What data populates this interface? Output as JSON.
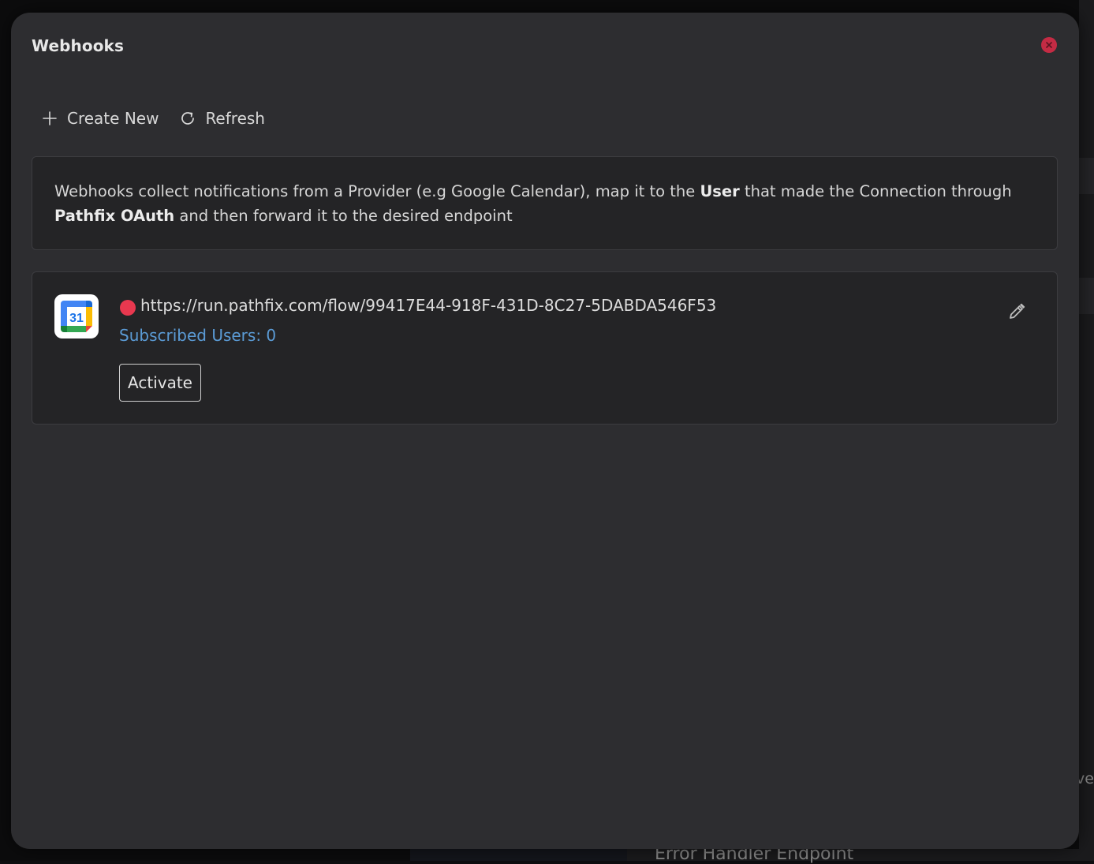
{
  "backdrop": {
    "peek_text": "ve",
    "bottom_text": "Error Handler Endpoint"
  },
  "modal": {
    "title": "Webhooks",
    "close_icon": "close-icon"
  },
  "toolbar": {
    "create_label": "Create New",
    "create_icon": "plus-icon",
    "refresh_label": "Refresh",
    "refresh_icon": "refresh-icon"
  },
  "info": {
    "part1": "Webhooks collect notifications from a Provider (e.g Google Calendar), map it to the ",
    "bold1": "User",
    "part2": " that made the Connection through ",
    "bold2": "Pathfix OAuth",
    "part3": " and then forward it to the desired endpoint"
  },
  "webhooks": [
    {
      "provider_icon": "google-calendar-icon",
      "calendar_day": "31",
      "status_color": "#e8384f",
      "url": "https://run.pathfix.com/flow/99417E44-918F-431D-8C27-5DABDA546F53",
      "subscribed_label": "Subscribed Users: 0",
      "activate_label": "Activate",
      "edit_icon": "pencil-icon"
    }
  ],
  "colors": {
    "modal_bg": "#2d2d30",
    "card_bg": "#242426",
    "link": "#5b9bd5",
    "close": "#c42b44",
    "status_inactive": "#e8384f"
  }
}
